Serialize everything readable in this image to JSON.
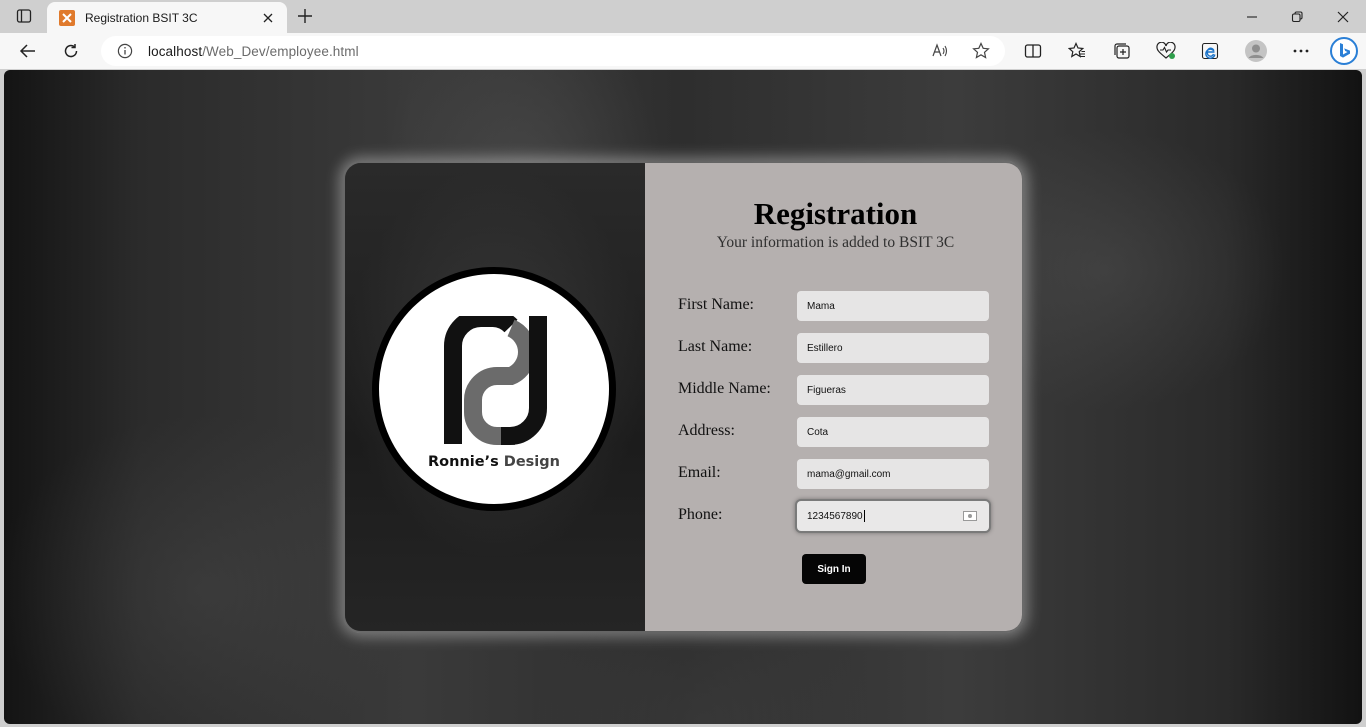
{
  "browser": {
    "tab_title": "Registration BSIT 3C",
    "url_host": "localhost",
    "url_path": "/Web_Dev/employee.html"
  },
  "icons": {
    "tab_actions": "tab-actions-icon",
    "favicon": "xampp-favicon",
    "close_tab": "close-icon",
    "new_tab": "plus-icon",
    "minimize": "minimize-icon",
    "restore": "restore-icon",
    "close_window": "close-icon",
    "back": "back-arrow-icon",
    "refresh": "refresh-icon",
    "site_info": "info-icon",
    "read_aloud": "read-aloud-icon",
    "favorite": "star-icon",
    "split_screen": "split-screen-icon",
    "favorites": "favorites-icon",
    "collections": "collections-icon",
    "browser_essentials": "heart-pulse-icon",
    "edge_ext": "edge-icon",
    "profile": "avatar-icon",
    "more": "more-icon",
    "copilot": "bing-icon"
  },
  "brand": {
    "name_part1": "Ronnie’s",
    "name_part2": "Design"
  },
  "form": {
    "title": "Registration",
    "subtitle": "Your information is added to BSIT 3C",
    "fields": [
      {
        "label": "First Name:",
        "value": "Mama"
      },
      {
        "label": "Last Name:",
        "value": "Estillero"
      },
      {
        "label": "Middle Name:",
        "value": "Figueras"
      },
      {
        "label": "Address:",
        "value": "Cota"
      },
      {
        "label": "Email:",
        "value": "mama@gmail.com"
      },
      {
        "label": "Phone:",
        "value": "1234567890"
      }
    ],
    "submit_label": "Sign In"
  },
  "colors": {
    "form_panel": "#b5b0af",
    "field_bg": "#e6e5e5",
    "button_bg": "#050505"
  }
}
